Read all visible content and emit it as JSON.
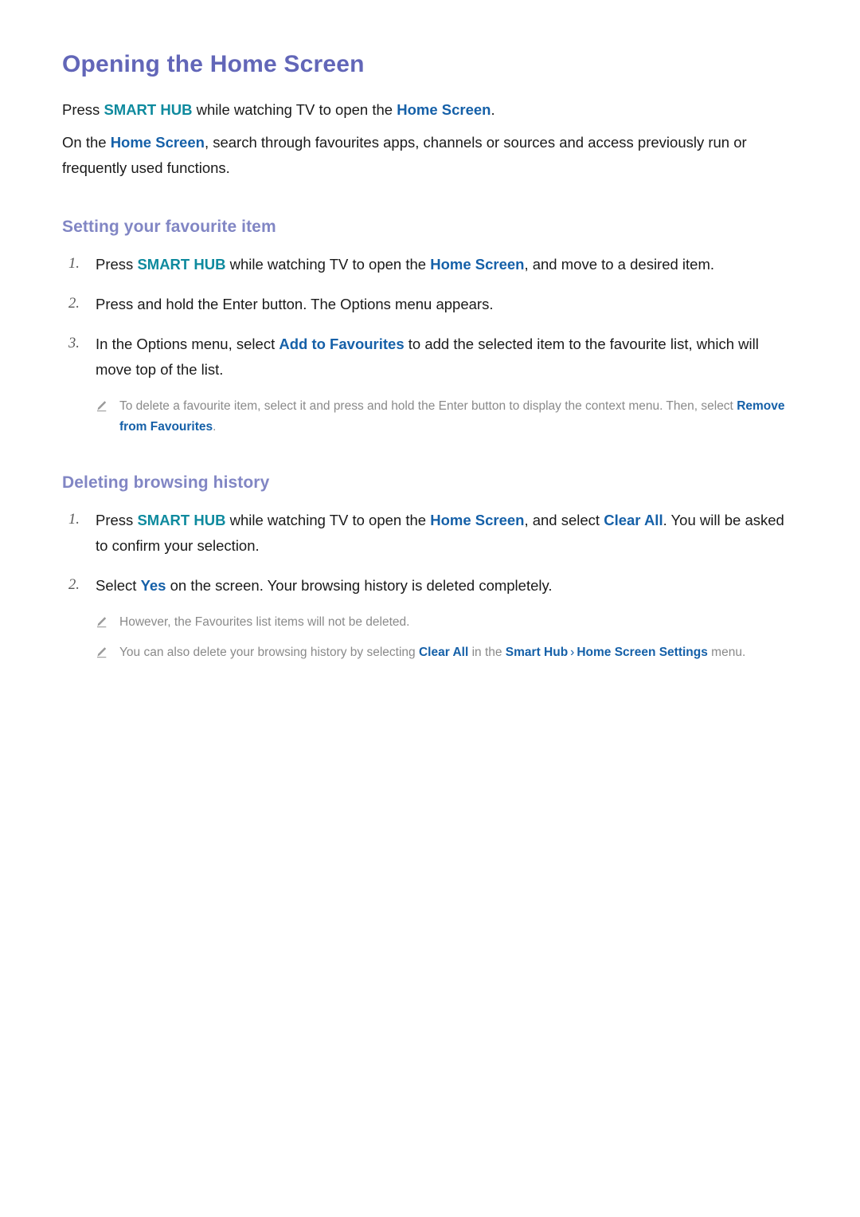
{
  "colors": {
    "title": "#6266b8",
    "subheading": "#8186c4",
    "body": "#1a1a1a",
    "keyword_teal": "#0e8a9e",
    "keyword_blue": "#1560a8",
    "note_text": "#8a8a8a",
    "step_number": "#595959",
    "background": "#ffffff"
  },
  "page": {
    "title": "Opening the Home Screen",
    "intro": {
      "p1": {
        "a": "Press ",
        "key1": "SMART HUB",
        "b": " while watching TV to open the ",
        "key2": "Home Screen",
        "c": "."
      },
      "p2": {
        "a": "On the ",
        "key1": "Home Screen",
        "b": ", search through favourites apps, channels or sources and access previously run or frequently used functions."
      }
    },
    "sections": [
      {
        "heading": "Setting your favourite item",
        "steps": [
          {
            "num": "1.",
            "a": "Press ",
            "key1": "SMART HUB",
            "b": " while watching TV to open the ",
            "key2": "Home Screen",
            "c": ", and move to a desired item."
          },
          {
            "num": "2.",
            "a": "Press and hold the Enter button. The Options menu appears.",
            "key1": "",
            "b": "",
            "key2": "",
            "c": ""
          },
          {
            "num": "3.",
            "a": "In the Options menu, select ",
            "key1": "Add to Favourites",
            "b": " to add the selected item to the favourite list, which will move top of the list.",
            "key2": "",
            "c": ""
          }
        ],
        "notes": [
          {
            "icon": "pencil-icon",
            "a": "To delete a favourite item, select it and press and hold the Enter button to display the context menu. Then, select ",
            "key1": "Remove from Favourites",
            "b": ".",
            "key2": "",
            "c": "",
            "key3": "",
            "d": ""
          }
        ]
      },
      {
        "heading": "Deleting browsing history",
        "steps": [
          {
            "num": "1.",
            "a": "Press ",
            "key1": "SMART HUB",
            "b": " while watching TV to open the ",
            "key2": "Home Screen",
            "c": ", and select ",
            "key3": "Clear All",
            "d": ". You will be asked to confirm your selection."
          },
          {
            "num": "2.",
            "a": "Select ",
            "key1": "Yes",
            "b": " on the screen. Your browsing history is deleted completely.",
            "key2": "",
            "c": ""
          }
        ],
        "notes": [
          {
            "icon": "pencil-icon",
            "a": "However, the Favourites list items will not be deleted.",
            "key1": "",
            "b": "",
            "key2": "",
            "c": "",
            "key3": "",
            "d": ""
          },
          {
            "icon": "pencil-icon",
            "a": "You can also delete your browsing history by selecting ",
            "key1": "Clear All",
            "b": " in the ",
            "key2": "Smart Hub",
            "separator": "›",
            "key3": "Home Screen Settings",
            "d": " menu."
          }
        ]
      }
    ]
  }
}
